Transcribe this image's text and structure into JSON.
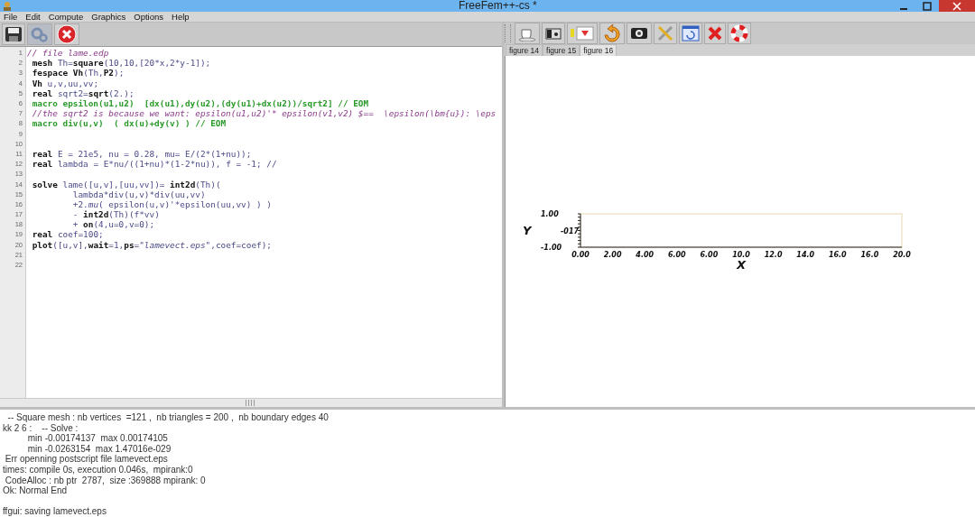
{
  "window": {
    "title": "FreeFem++-cs *"
  },
  "menu": [
    "File",
    "Edit",
    "Compute",
    "Graphics",
    "Options",
    "Help"
  ],
  "editor": {
    "lines": [
      {
        "number": "1",
        "kind": "comment",
        "text": "// file lame.edp"
      },
      {
        "number": "2",
        "kind": "code",
        "text": " **mesh** Th=**square**(10,10,[20*x,2*y-1]);"
      },
      {
        "number": "3",
        "kind": "code",
        "text": " **fespace** **Vh**(Th,**P2**);"
      },
      {
        "number": "4",
        "kind": "code",
        "text": " **Vh** u,v,uu,vv;"
      },
      {
        "number": "5",
        "kind": "code",
        "text": " **real** sqrt2=**sqrt**(2.);"
      },
      {
        "number": "6",
        "kind": "macro",
        "text": " macro epsilon(u1,u2)  [dx(u1),dy(u2),(dy(u1)+dx(u2))/sqrt2] // EOM"
      },
      {
        "number": "7",
        "kind": "comment",
        "text": " //the sqrt2 is because we want: epsilon(u1,u2)'* epsilon(v1,v2) $==  \\epsilon(\\bm{u}): \\eps"
      },
      {
        "number": "8",
        "kind": "macro",
        "text": " macro div(u,v)  ( dx(u)+dy(v) ) // EOM"
      },
      {
        "number": "9",
        "kind": "code"
      },
      {
        "number": "10",
        "kind": "code"
      },
      {
        "number": "11",
        "kind": "code",
        "text": " **real** E = 21e5, nu = 0.28, mu= E/(2*(1+nu));"
      },
      {
        "number": "12",
        "kind": "code",
        "text": " **real** lambda = E*nu/((1+nu)*(1-2*nu)), f = -1; //"
      },
      {
        "number": "13",
        "kind": "code"
      },
      {
        "number": "14",
        "kind": "code",
        "text": " **solve** lame([u,v],[uu,vv])= **int2d**(Th)("
      },
      {
        "number": "15",
        "kind": "code",
        "text": "         lambda*div(u,v)*div(uu,vv)"
      },
      {
        "number": "16",
        "kind": "code",
        "text": "         +2.*mu*( epsilon(u,v)'*epsilon(uu,vv) ) )"
      },
      {
        "number": "17",
        "kind": "code",
        "text": "         - **int2d**(Th)(f*vv)"
      },
      {
        "number": "18",
        "kind": "code",
        "text": "         + **on**(4,u=0,v=0);"
      },
      {
        "number": "19",
        "kind": "code",
        "text": " **real** coef=100;"
      },
      {
        "number": "20",
        "kind": "code",
        "text": " **plot**([u,v],**wait**=1,**ps**=*\"lamevect.eps\"*,coef=coef);"
      },
      {
        "number": "21",
        "kind": "code"
      },
      {
        "number": "22",
        "kind": "code"
      }
    ]
  },
  "figure_tabs": [
    {
      "label": "figure 14",
      "selected": false
    },
    {
      "label": "figure 15",
      "selected": false
    },
    {
      "label": "figure 16",
      "selected": true
    }
  ],
  "plot": {
    "xlabel": "X",
    "ylabel": "Y",
    "x_tick_labels": [
      "0.00",
      "2.00",
      "4.00",
      "6.00",
      "6.00",
      "10.0",
      "12.0",
      "14.0",
      "16.0",
      "16.0",
      "20.0"
    ],
    "y_tick_labels": [
      "1.00",
      "-017",
      "-1.00"
    ]
  },
  "output": [
    {
      "kind": "text",
      "text": "  -- Square mesh : nb vertices  =121 ,  nb triangles = 200 ,  nb boundary edges 40"
    },
    {
      "kind": "text",
      "text": "kk 2 6 :    -- Solve :"
    },
    {
      "kind": "text",
      "text": "          min -0.00174137  max 0.00174105"
    },
    {
      "kind": "text",
      "text": "          min -0.0263154  max 1.47016e-029"
    },
    {
      "kind": "text",
      "text": " Err openning postscript file lamevect.eps"
    },
    {
      "kind": "text",
      "text": "times: compile 0s, execution 0.046s,  mpirank:0"
    },
    {
      "kind": "text",
      "text": " CodeAlloc : nb ptr  2787,  size :369888 mpirank: 0"
    },
    {
      "kind": "text",
      "text": "Ok: Normal End"
    },
    {
      "kind": "blank"
    },
    {
      "kind": "text",
      "text": "ffgui: saving lamevect.eps"
    }
  ]
}
